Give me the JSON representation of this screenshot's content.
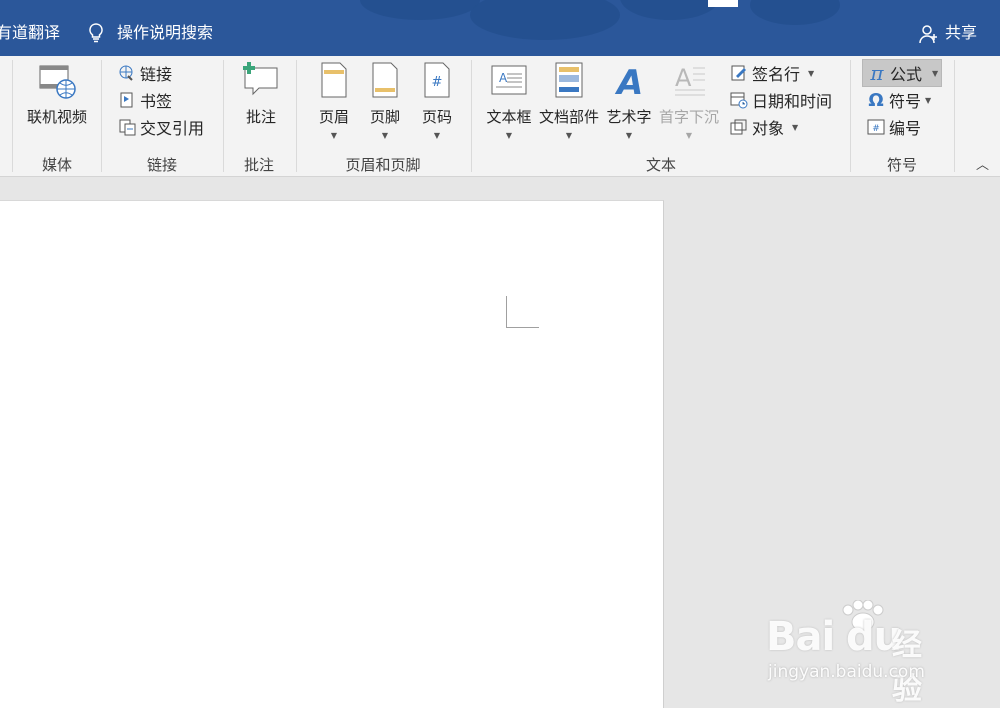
{
  "title_bar": {
    "translate_label": "有道翻译",
    "tell_me": "操作说明搜索",
    "share": "共享"
  },
  "ribbon": {
    "media": {
      "online_video": "联机视频",
      "group": "媒体"
    },
    "links": {
      "link": "链接",
      "bookmark": "书签",
      "cross_ref": "交叉引用",
      "group": "链接"
    },
    "comments": {
      "comment": "批注",
      "group": "批注"
    },
    "header_footer": {
      "header": "页眉",
      "footer": "页脚",
      "page_number": "页码",
      "group": "页眉和页脚"
    },
    "text": {
      "text_box": "文本框",
      "quick_parts": "文档部件",
      "wordart": "艺术字",
      "drop_cap": "首字下沉",
      "signature_line": "签名行",
      "date_time": "日期和时间",
      "object": "对象",
      "group": "文本"
    },
    "symbols": {
      "equation": "公式",
      "symbol": "符号",
      "number": "编号",
      "group": "符号"
    }
  },
  "watermark": {
    "logo": "Bai",
    "logo2": "du",
    "brand": "经验",
    "url": "jingyan.baidu.com"
  }
}
